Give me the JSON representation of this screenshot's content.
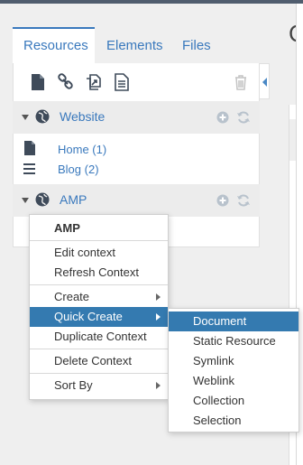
{
  "page": {
    "title_fragment": "C",
    "link_fragment": "C"
  },
  "tabs": [
    {
      "label": "Resources",
      "active": true
    },
    {
      "label": "Elements",
      "active": false
    },
    {
      "label": "Files",
      "active": false
    }
  ],
  "toolbar": {
    "icons": [
      "new-document-icon",
      "new-weblink-icon",
      "new-symlink-icon",
      "new-static-resource-icon",
      "purge-trash-icon"
    ]
  },
  "contexts": [
    {
      "label": "Website",
      "items": [
        {
          "label": "Home (1)",
          "icon": "document-icon"
        },
        {
          "label": "Blog (2)",
          "icon": "list-icon"
        }
      ]
    },
    {
      "label": "AMP",
      "items": []
    }
  ],
  "context_menu": {
    "header": "AMP",
    "items": [
      {
        "label": "Edit context"
      },
      {
        "label": "Refresh Context"
      },
      {
        "label": "Create"
      },
      {
        "label": "Quick Create"
      },
      {
        "label": "Duplicate Context"
      },
      {
        "label": "Delete Context"
      },
      {
        "label": "Sort By"
      }
    ]
  },
  "quick_create_menu": {
    "items": [
      {
        "label": "Document"
      },
      {
        "label": "Static Resource"
      },
      {
        "label": "Symlink"
      },
      {
        "label": "Weblink"
      },
      {
        "label": "Collection"
      },
      {
        "label": "Selection"
      }
    ]
  },
  "colors": {
    "accent": "#3a79bd",
    "menu_highlight": "#347ab0",
    "topbar": "#505d6e"
  }
}
